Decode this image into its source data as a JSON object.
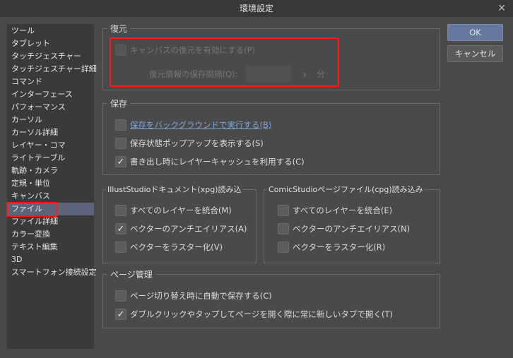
{
  "window": {
    "title": "環境設定",
    "close": "✕"
  },
  "sidebar": {
    "items": [
      "ツール",
      "タブレット",
      "タッチジェスチャー",
      "タッチジェスチャー詳細",
      "コマンド",
      "インターフェース",
      "パフォーマンス",
      "カーソル",
      "カーソル詳細",
      "レイヤー・コマ",
      "ライトテーブル",
      "軌跡・カメラ",
      "定規・単位",
      "キャンバス",
      "ファイル",
      "ファイル詳細",
      "カラー変換",
      "テキスト編集",
      "3D",
      "スマートフォン接続設定"
    ],
    "selected": "ファイル"
  },
  "restore": {
    "title": "復元",
    "enable": {
      "label": "キャンバスの復元を有効にする(P)",
      "checked": false,
      "disabled": true
    },
    "interval_label": "復元情報の保存間隔(Q):",
    "interval_value": "",
    "arrow": "›",
    "unit": "分"
  },
  "save": {
    "title": "保存",
    "items": [
      {
        "label": "保存をバックグラウンドで実行する(B)",
        "checked": false
      },
      {
        "label": "保存状態ポップアップを表示する(S)",
        "checked": false
      },
      {
        "label": "書き出し時にレイヤーキャッシュを利用する(C)",
        "checked": true
      }
    ]
  },
  "illust": {
    "title": "IllustStudioドキュメント(xpg)読み込",
    "items": [
      {
        "label": "すべてのレイヤーを統合(M)",
        "checked": false
      },
      {
        "label": "ベクターのアンチエイリアス(A)",
        "checked": true
      },
      {
        "label": "ベクターをラスター化(V)",
        "checked": false
      }
    ]
  },
  "comic": {
    "title": "ComicStudioページファイル(cpg)読み込み",
    "items": [
      {
        "label": "すべてのレイヤーを統合(E)",
        "checked": false
      },
      {
        "label": "ベクターのアンチエイリアス(N)",
        "checked": false
      },
      {
        "label": "ベクターをラスター化(R)",
        "checked": false
      }
    ]
  },
  "page": {
    "title": "ページ管理",
    "items": [
      {
        "label": "ページ切り替え時に自動で保存する(C)",
        "checked": false
      },
      {
        "label": "ダブルクリックやタップしてページを開く際に常に新しいタブで開く(T)",
        "checked": true
      }
    ]
  },
  "buttons": {
    "ok": "OK",
    "cancel": "キャンセル"
  },
  "check_mark": "✓"
}
